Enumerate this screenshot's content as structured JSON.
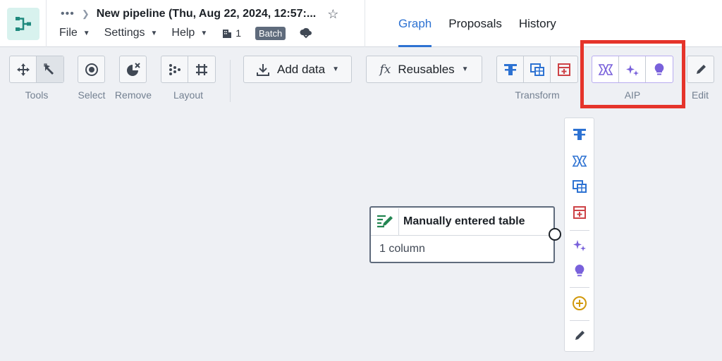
{
  "header": {
    "title": "New pipeline (Thu, Aug 22, 2024, 12:57:...",
    "menus": [
      "File",
      "Settings",
      "Help"
    ],
    "branch_count": "1",
    "batch_label": "Batch",
    "tabs": [
      "Graph",
      "Proposals",
      "History"
    ],
    "active_tab": "Graph"
  },
  "toolbar": {
    "groups": {
      "tools": "Tools",
      "select": "Select",
      "remove": "Remove",
      "layout": "Layout",
      "transform": "Transform",
      "aip": "AIP",
      "edit": "Edit"
    },
    "add_data": "Add data",
    "reusables": "Reusables"
  },
  "node": {
    "title": "Manually entered table",
    "subtitle": "1 column"
  },
  "colors": {
    "accent": "#2d72d2",
    "highlight": "#e5342b",
    "aip_purple": "#7961db",
    "transform_red": "#cd4246",
    "green": "#238551",
    "gold": "#d1980b"
  }
}
